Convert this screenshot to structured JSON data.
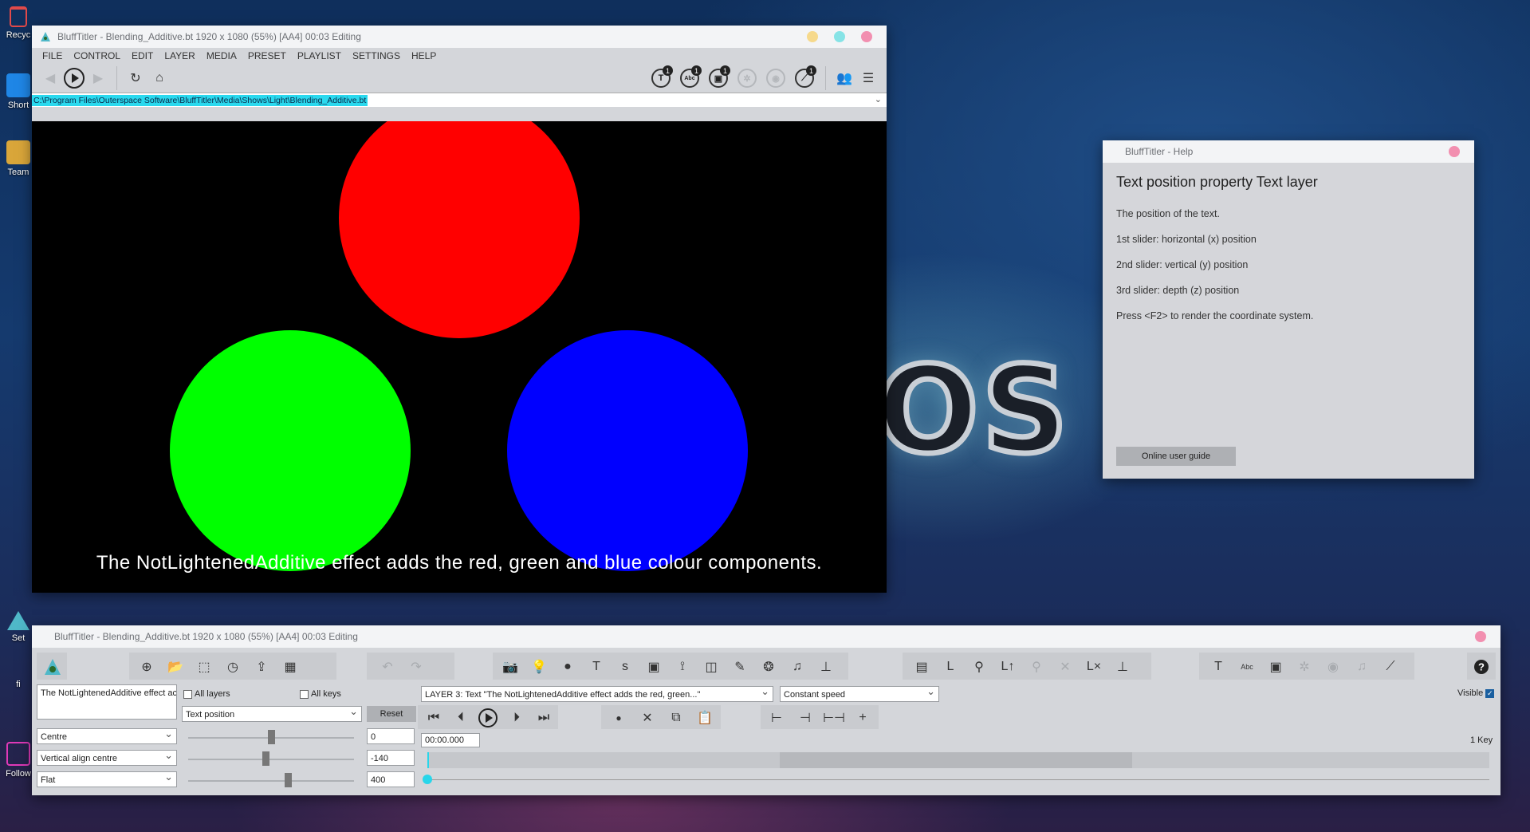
{
  "desktop": {
    "icons": [
      {
        "label": "Recyc",
        "color": "#e14a4a"
      },
      {
        "label": "Short",
        "color": "#1f86e6"
      },
      {
        "label": "Team",
        "color": "#d9a63a"
      },
      {
        "label": "Set",
        "color": "#4fb8c8"
      },
      {
        "label": "fi",
        "color": "#777"
      },
      {
        "label": "Follow",
        "color": "#e03ab8"
      }
    ],
    "bg_logo": "OS"
  },
  "main_window": {
    "title": "BluffTitler - Blending_Additive.bt 1920 x 1080 (55%) [AA4] 00:03 Editing",
    "menu": [
      "FILE",
      "CONTROL",
      "EDIT",
      "LAYER",
      "MEDIA",
      "PRESET",
      "PLAYLIST",
      "SETTINGS",
      "HELP"
    ],
    "badges": [
      {
        "icon": "text-layer-icon",
        "glyph": "T",
        "count": "1",
        "dim": false
      },
      {
        "icon": "abc-layer-icon",
        "glyph": "Abc",
        "count": "1",
        "dim": false
      },
      {
        "icon": "picture-layer-icon",
        "glyph": "▣",
        "count": "1",
        "dim": false
      },
      {
        "icon": "particle-icon",
        "glyph": "✲",
        "count": "",
        "dim": true
      },
      {
        "icon": "media-icon",
        "glyph": "◉",
        "count": "",
        "dim": true
      },
      {
        "icon": "tool-icon",
        "glyph": "⟋",
        "count": "1",
        "dim": false
      }
    ],
    "path": "C:\\Program Files\\Outerspace Software\\BluffTitler\\Media\\Shows\\Light\\Blending_Additive.bt",
    "caption": "The NotLightenedAdditive effect adds the red, green and blue colour components.",
    "colors": {
      "red": "#ff0000",
      "green": "#00ff00",
      "blue": "#0000ff"
    }
  },
  "help_window": {
    "title": "BluffTitler - Help",
    "heading": "Text position property Text layer",
    "lines": [
      "The position of the text.",
      "1st slider: horizontal (x) position",
      "2nd slider: vertical (y) position",
      "3rd slider: depth (z) position",
      "Press <F2> to render the coordinate system."
    ],
    "button": "Online user guide"
  },
  "control_window": {
    "title": "BluffTitler - Blending_Additive.bt 1920 x 1080 (55%) [AA4] 00:03 Editing",
    "text_field": "The NotLightenedAdditive effect ac",
    "all_layers": "All layers",
    "all_keys": "All keys",
    "property": "Text position",
    "reset": "Reset",
    "layer_select": "LAYER 3: Text \"The NotLightenedAdditive effect adds the red, green...\"",
    "speed_select": "Constant speed",
    "visible": "Visible",
    "align_h": "Centre",
    "align_v": "Vertical align centre",
    "depth_mode": "Flat",
    "x_value": "0",
    "y_value": "-140",
    "z_value": "400",
    "time": "00:00.000",
    "keys": "1 Key"
  }
}
